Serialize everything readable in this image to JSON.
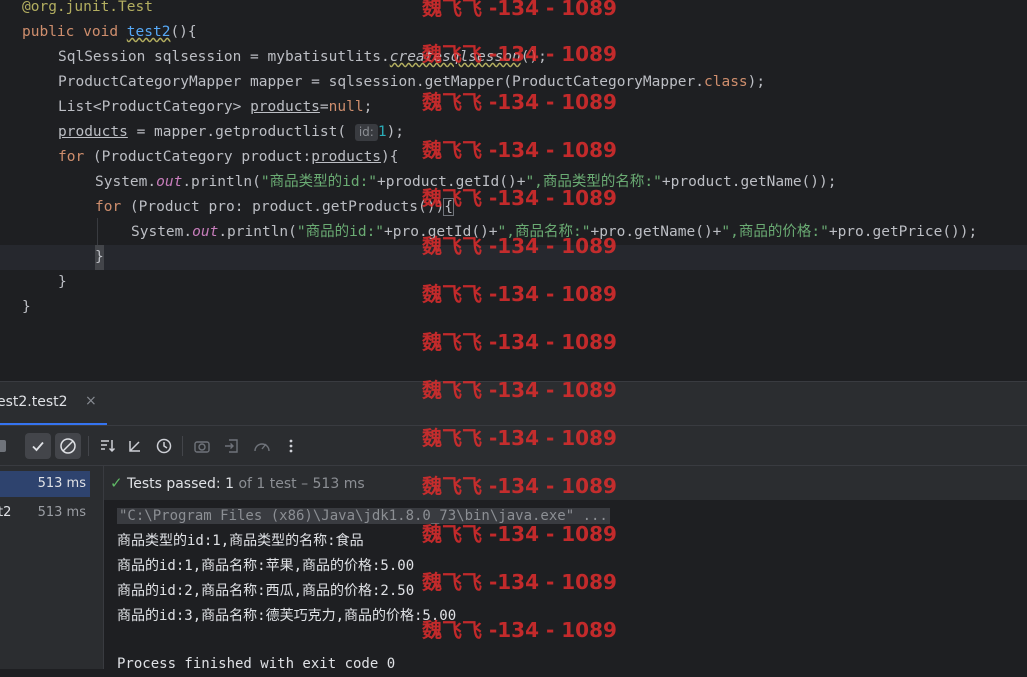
{
  "editor": {
    "lines": {
      "l1_annotation": "@org.junit.Test",
      "l2_public": "public",
      "l2_void": "void",
      "l2_method": "test2",
      "l2_rest": "(){",
      "l3_a": "SqlSession sqlsession = mybatisutlits.",
      "l3_b": "createsqlsesson",
      "l3_c": "();",
      "l4_a": "ProductCategoryMapper mapper = sqlsession.getMapper(ProductCategoryMapper.",
      "l4_class": "class",
      "l4_c": ");",
      "l5_a": "List<ProductCategory> ",
      "l5_var": "products",
      "l5_eq": "=",
      "l5_null": "null",
      "l5_c": ";",
      "l6_var": "products",
      "l6_a": " = mapper.getproductlist( ",
      "l6_hint": "id:",
      "l6_num": "1",
      "l6_c": ");",
      "l7_for": "for",
      "l7_a": " (ProductCategory product:",
      "l7_var": "products",
      "l7_c": "){",
      "l8_a": "System.",
      "l8_out": "out",
      "l8_b": ".println(",
      "l8_s1": "\"商品类型的id:\"",
      "l8_c": "+product.getId()+",
      "l8_s2": "\",商品类型的名称:\"",
      "l8_d": "+product.getName());",
      "l9_for": "for",
      "l9_a": " (Product pro: product.getProducts())",
      "l9_brace": "{",
      "l10_a": "System.",
      "l10_out": "out",
      "l10_b": ".println(",
      "l10_s1": "\"商品的id:\"",
      "l10_c": "+pro.getId()+",
      "l10_s2": "\",商品名称:\"",
      "l10_d": "+pro.getName()+",
      "l10_s3": "\",商品的价格:\"",
      "l10_e": "+pro.getPrice());",
      "l11_brace": "}",
      "l12_brace": "}",
      "l13_brace": "}"
    }
  },
  "run": {
    "tab_label": "est2.test2",
    "tab_close": "×",
    "toolbar_icons": [
      "stop-icon",
      "check-icon",
      "ignored-icon",
      "sort-icon",
      "collapse-icon",
      "history-icon",
      "camera-icon",
      "import-icon",
      "gauge-icon",
      "more-icon"
    ],
    "tree": [
      {
        "name": "",
        "time": "513 ms"
      },
      {
        "name": "t2",
        "time": "513 ms"
      }
    ],
    "status": {
      "check": "✓",
      "label": "Tests passed: 1",
      "suffix": "of 1 test – 513 ms"
    },
    "console_lines": {
      "cmd": "\"C:\\Program Files (x86)\\Java\\jdk1.8.0_73\\bin\\java.exe\" ...",
      "o1": "商品类型的id:1,商品类型的名称:食品",
      "o2": "商品的id:1,商品名称:苹果,商品的价格:5.00",
      "o3": "商品的id:2,商品名称:西瓜,商品的价格:2.50",
      "o4": "商品的id:3,商品名称:德芙巧克力,商品的价格:5.00",
      "o5": "Process finished with exit code 0"
    }
  },
  "watermark": "魏飞飞 -134 - 1089"
}
